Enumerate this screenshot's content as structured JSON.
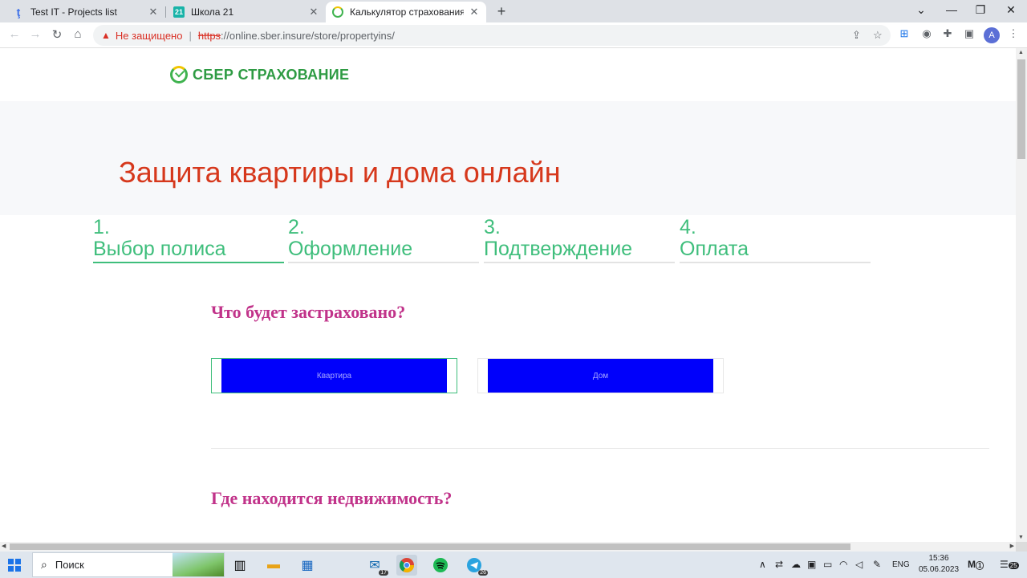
{
  "browser": {
    "tabs": [
      {
        "title": "Test IT - Projects list",
        "favicon": "t"
      },
      {
        "title": "Школа 21",
        "favicon": "21"
      },
      {
        "title": "Калькулятор страхования частн",
        "favicon": "sber"
      }
    ],
    "new_tab": "+",
    "window_controls": {
      "menu": "⌄",
      "minimize": "—",
      "maximize": "❐",
      "close": "✕"
    },
    "security_warning": "Не защищено",
    "url_scheme": "https",
    "url_rest": "://online.sber.insure/store/propertyins/",
    "avatar_letter": "A"
  },
  "site": {
    "logo_text": "СБЕР СТРАХОВАНИЕ",
    "title": "Защита квартиры и дома онлайн",
    "steps": [
      {
        "num": "1.",
        "label": "Выбор полиса",
        "active": true
      },
      {
        "num": "2.",
        "label": "Оформление",
        "active": false
      },
      {
        "num": "3.",
        "label": "Подтверждение",
        "active": false
      },
      {
        "num": "4.",
        "label": "Оплата",
        "active": false
      }
    ],
    "question1": "Что будет застраховано?",
    "options": [
      {
        "label": "Квартира",
        "selected": true
      },
      {
        "label": "Дом",
        "selected": false
      }
    ],
    "question2": "Где находится недвижимость?"
  },
  "taskbar": {
    "search_placeholder": "Поиск",
    "mail_badge": "17",
    "telegram_badge": "26",
    "language": "ENG",
    "time": "15:36",
    "date": "05.06.2023",
    "notification_count": "25",
    "m_badge": "1"
  },
  "colors": {
    "brand_green": "#3fbe7c",
    "title_red": "#d6381c",
    "question_magenta": "#c1338a",
    "option_fill": "#0000fb"
  }
}
